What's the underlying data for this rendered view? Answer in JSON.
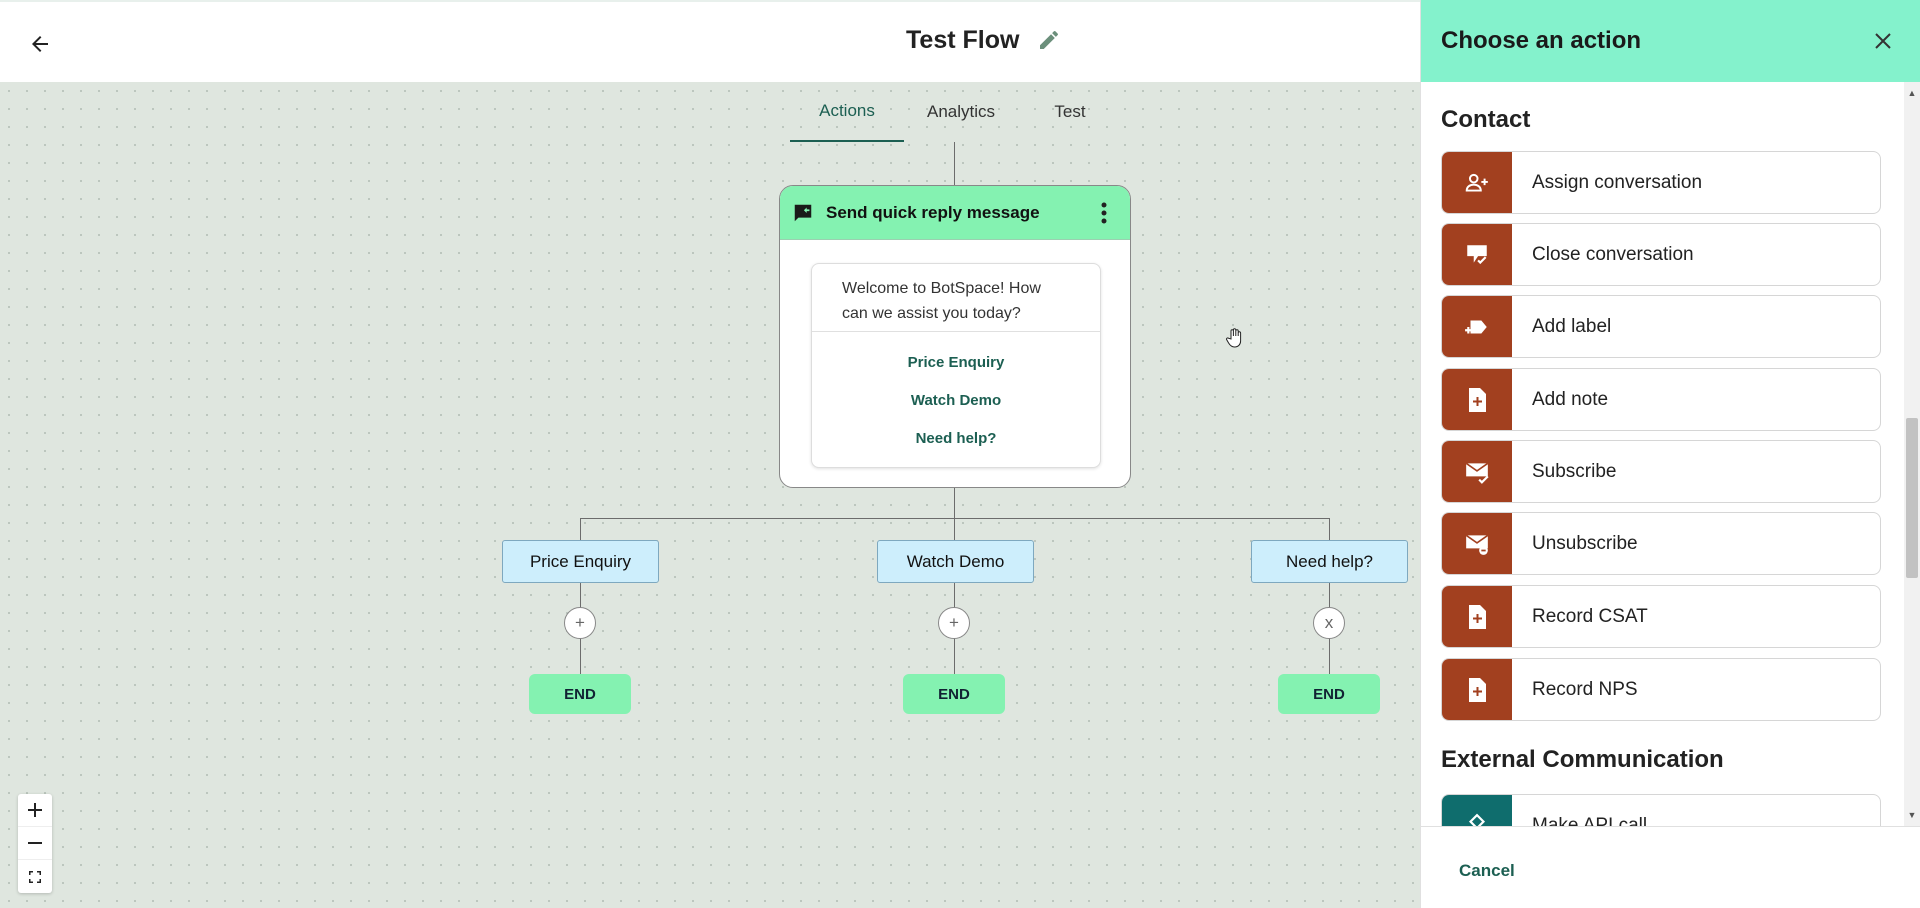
{
  "header": {
    "title": "Test Flow"
  },
  "tabs": [
    {
      "label": "Actions",
      "active": true
    },
    {
      "label": "Analytics",
      "active": false
    },
    {
      "label": "Test",
      "active": false
    }
  ],
  "node": {
    "title": "Send quick reply message",
    "message": "Welcome to BotSpace! How can we assist you today?",
    "quick_replies": [
      "Price Enquiry",
      "Watch Demo",
      "Need help?"
    ]
  },
  "branches": [
    {
      "label": "Price Enquiry",
      "connector": "+",
      "end": "END"
    },
    {
      "label": "Watch Demo",
      "connector": "+",
      "end": "END"
    },
    {
      "label": "Need help?",
      "connector": "x",
      "end": "END"
    }
  ],
  "zoom_controls": {
    "zoom_in": "+",
    "zoom_out": "−"
  },
  "panel": {
    "title": "Choose an action",
    "sections": [
      {
        "title": "Contact",
        "actions": [
          {
            "label": "Assign conversation",
            "icon": "person-add-icon"
          },
          {
            "label": "Close conversation",
            "icon": "chat-check-icon"
          },
          {
            "label": "Add label",
            "icon": "label-add-icon"
          },
          {
            "label": "Add note",
            "icon": "note-add-icon"
          },
          {
            "label": "Subscribe",
            "icon": "mail-check-icon"
          },
          {
            "label": "Unsubscribe",
            "icon": "mail-minus-icon"
          },
          {
            "label": "Record CSAT",
            "icon": "file-add-icon"
          },
          {
            "label": "Record NPS",
            "icon": "file-add-icon"
          }
        ]
      },
      {
        "title": "External Communication",
        "actions": [
          {
            "label": "Make API call",
            "icon": "api-icon"
          }
        ]
      }
    ],
    "cancel_label": "Cancel"
  },
  "colors": {
    "accent_green": "#84f2b1",
    "panel_header": "#84f2cc",
    "action_icon_bg": "#a2401f",
    "teal_icon_bg": "#0f6d6d",
    "link_green": "#1c5f52",
    "branch_bg": "#cdeefc",
    "canvas_bg": "#dfe6df"
  }
}
